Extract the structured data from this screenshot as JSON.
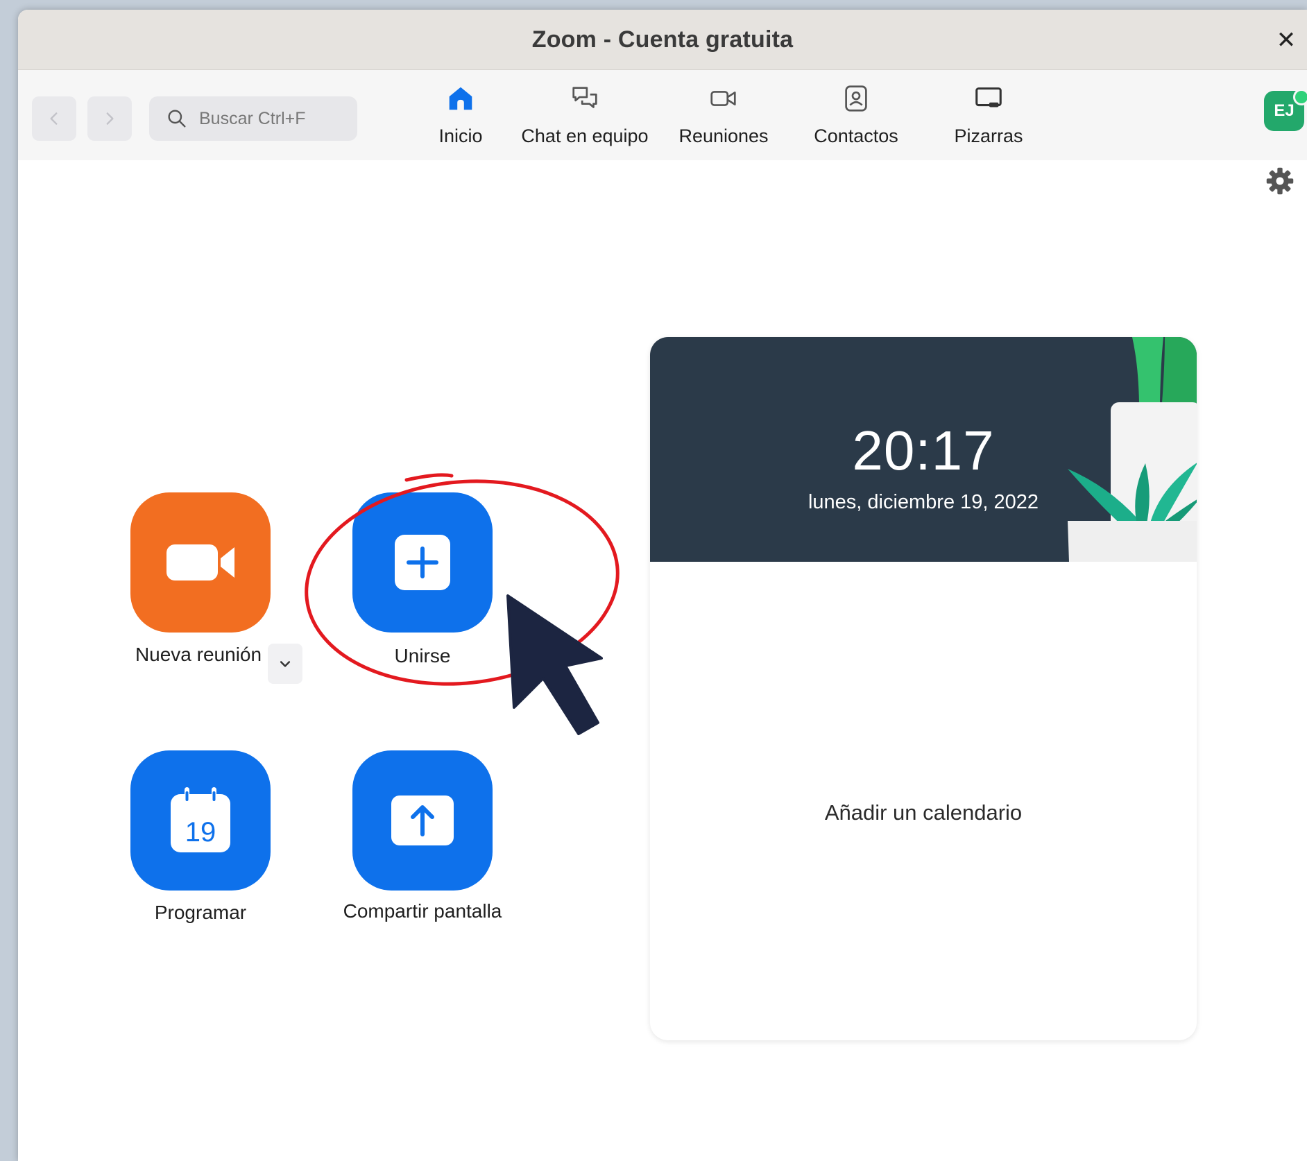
{
  "window": {
    "title": "Zoom - Cuenta gratuita"
  },
  "toolbar": {
    "search_placeholder": "Buscar Ctrl+F",
    "tabs": [
      {
        "label": "Inicio",
        "icon": "home-icon",
        "active": true
      },
      {
        "label": "Chat en equipo",
        "icon": "chat-icon",
        "active": false
      },
      {
        "label": "Reuniones",
        "icon": "video-camera-icon",
        "active": false
      },
      {
        "label": "Contactos",
        "icon": "contacts-icon",
        "active": false
      },
      {
        "label": "Pizarras",
        "icon": "whiteboard-icon",
        "active": false
      }
    ],
    "avatar_initials": "EJ"
  },
  "actions": {
    "new_meeting": "Nueva reunión",
    "join": "Unirse",
    "schedule": "Programar",
    "schedule_day": "19",
    "share_screen": "Compartir pantalla"
  },
  "calendar_card": {
    "time": "20:17",
    "date": "lunes, diciembre 19, 2022",
    "add_calendar": "Añadir un calendario"
  },
  "colors": {
    "accent_blue": "#0e71eb",
    "new_meeting_orange": "#f26e21",
    "annotation_red": "#e3191f",
    "status_green": "#23a86b",
    "card_header": "#2b3a49"
  }
}
